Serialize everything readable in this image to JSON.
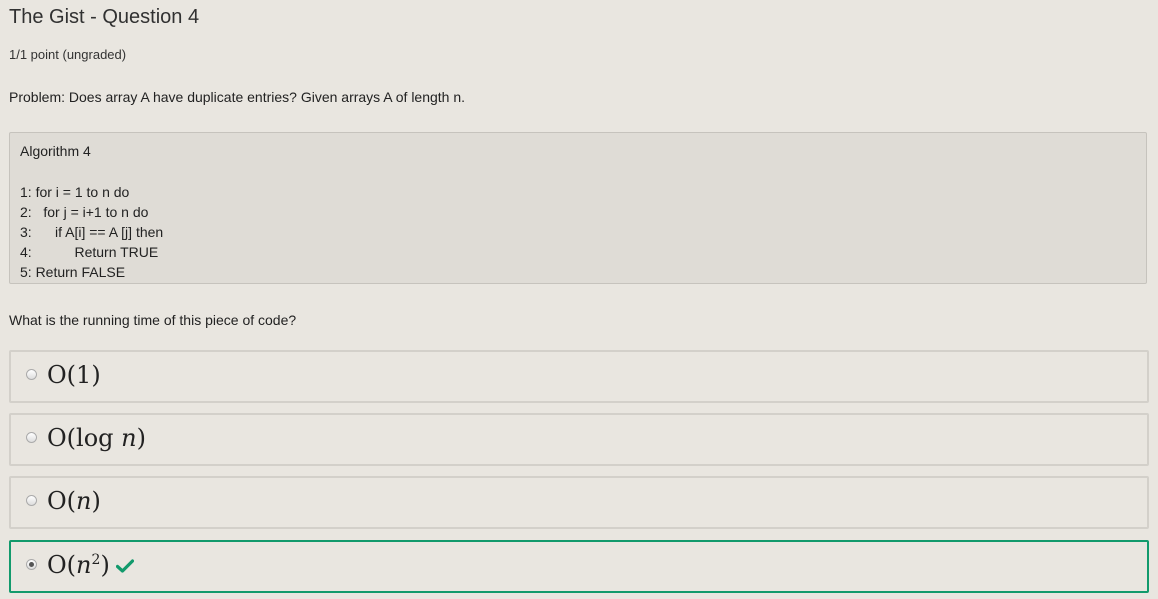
{
  "header": {
    "title": "The Gist - Question 4",
    "points": "1/1 point (ungraded)"
  },
  "problem": "Problem: Does array A have duplicate entries? Given arrays A of length n.",
  "algorithm": {
    "title": "Algorithm 4",
    "lines": [
      "1: for i = 1 to n do",
      "2:   for j = i+1 to n do",
      "3:      if A[i] == A [j] then",
      "4:           Return TRUE",
      "5: Return FALSE"
    ]
  },
  "question": "What is the running time of this piece of code?",
  "options": [
    {
      "prefix": "O(",
      "var": "1",
      "suffix": ")",
      "selected": false,
      "correct": false
    },
    {
      "prefix": "O(log ",
      "var": "n",
      "suffix": ")",
      "selected": false,
      "correct": false
    },
    {
      "prefix": "O(",
      "var": "n",
      "suffix": ")",
      "selected": false,
      "correct": false
    },
    {
      "prefix": "O(",
      "var": "n",
      "sup": "2",
      "suffix": ")",
      "selected": true,
      "correct": true
    }
  ],
  "colors": {
    "correct": "#129a6c",
    "background": "#e9e6e0"
  },
  "icons": {
    "correct_indicator": "checkmark-icon"
  }
}
